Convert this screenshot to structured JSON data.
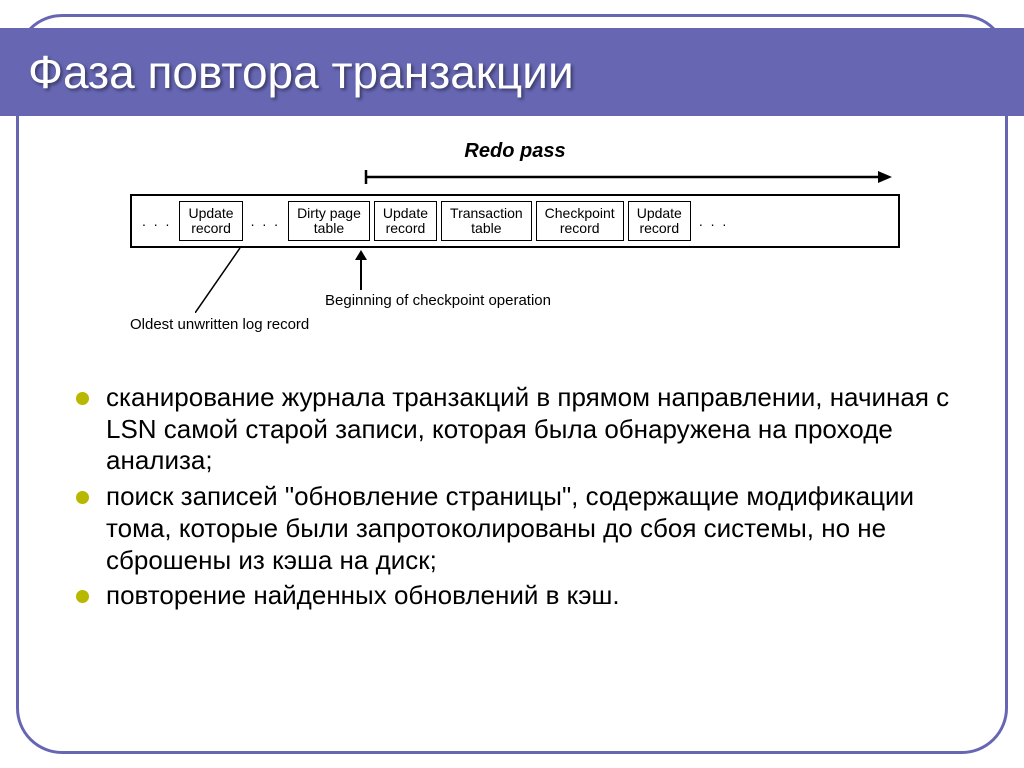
{
  "title": "Фаза повтора транзакции",
  "diagram": {
    "redo_label": "Redo pass",
    "records": [
      "Update\nrecord",
      "Dirty page\ntable",
      "Update\nrecord",
      "Transaction\ntable",
      "Checkpoint\nrecord",
      "Update\nrecord"
    ],
    "ellipsis": ". . .",
    "ann_oldest": "Oldest unwritten log record",
    "ann_begin": "Beginning of checkpoint operation"
  },
  "bullets": [
    "сканирование журнала транзакций в прямом направлении, начиная с LSN самой старой записи, которая была обнаружена на проходе анализа;",
    "поиск записей \"обновление страницы\", содержащие модификации тома, которые были запротоколированы до сбоя системы, но не сброшены из кэша на диск;",
    "повторение найденных обновлений в кэш."
  ]
}
